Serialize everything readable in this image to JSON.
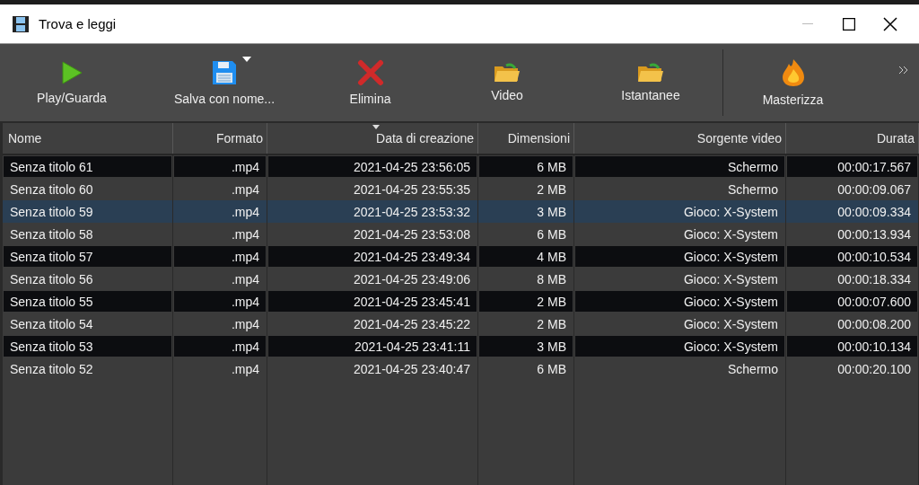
{
  "window": {
    "title": "Trova e leggi"
  },
  "toolbar": [
    {
      "kind": "play",
      "label": "Play/Guarda",
      "dropdown": false
    },
    {
      "kind": "save",
      "label": "Salva con nome...",
      "dropdown": true
    },
    {
      "kind": "delete",
      "label": "Elimina",
      "dropdown": false
    },
    {
      "kind": "folder",
      "label": "Video",
      "dropdown": false
    },
    {
      "kind": "folder",
      "label": "Istantanee",
      "dropdown": false
    },
    {
      "kind": "burn",
      "label": "Masterizza",
      "dropdown": false
    }
  ],
  "table": {
    "columns": [
      {
        "label": "Nome",
        "sorted": false
      },
      {
        "label": "Formato",
        "sorted": false
      },
      {
        "label": "Data di creazione",
        "sorted": true
      },
      {
        "label": "Dimensioni",
        "sorted": false
      },
      {
        "label": "Sorgente video",
        "sorted": false
      },
      {
        "label": "Durata",
        "sorted": false
      }
    ],
    "rows": [
      {
        "selected": false,
        "cells": [
          "Senza titolo 61",
          ".mp4",
          "2021-04-25 23:56:05",
          "6 MB",
          "Schermo",
          "00:00:17.567"
        ]
      },
      {
        "selected": false,
        "cells": [
          "Senza titolo 60",
          ".mp4",
          "2021-04-25 23:55:35",
          "2 MB",
          "Schermo",
          "00:00:09.067"
        ]
      },
      {
        "selected": true,
        "cells": [
          "Senza titolo 59",
          ".mp4",
          "2021-04-25 23:53:32",
          "3 MB",
          "Gioco: X-System",
          "00:00:09.334"
        ]
      },
      {
        "selected": false,
        "cells": [
          "Senza titolo 58",
          ".mp4",
          "2021-04-25 23:53:08",
          "6 MB",
          "Gioco: X-System",
          "00:00:13.934"
        ]
      },
      {
        "selected": false,
        "cells": [
          "Senza titolo 57",
          ".mp4",
          "2021-04-25 23:49:34",
          "4 MB",
          "Gioco: X-System",
          "00:00:10.534"
        ]
      },
      {
        "selected": false,
        "cells": [
          "Senza titolo 56",
          ".mp4",
          "2021-04-25 23:49:06",
          "8 MB",
          "Gioco: X-System",
          "00:00:18.334"
        ]
      },
      {
        "selected": false,
        "cells": [
          "Senza titolo 55",
          ".mp4",
          "2021-04-25 23:45:41",
          "2 MB",
          "Gioco: X-System",
          "00:00:07.600"
        ]
      },
      {
        "selected": false,
        "cells": [
          "Senza titolo 54",
          ".mp4",
          "2021-04-25 23:45:22",
          "2 MB",
          "Gioco: X-System",
          "00:00:08.200"
        ]
      },
      {
        "selected": false,
        "cells": [
          "Senza titolo 53",
          ".mp4",
          "2021-04-25 23:41:11",
          "3 MB",
          "Gioco: X-System",
          "00:00:10.134"
        ]
      },
      {
        "selected": false,
        "cells": [
          "Senza titolo 52",
          ".mp4",
          "2021-04-25 23:40:47",
          "6 MB",
          "Schermo",
          "00:00:20.100"
        ]
      }
    ]
  }
}
